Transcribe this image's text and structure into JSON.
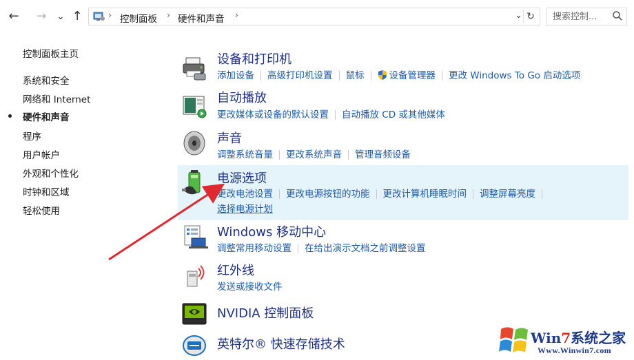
{
  "nav": {
    "back": "←",
    "forward": "→",
    "recent": "⌄",
    "up": "↑"
  },
  "address": {
    "breadcrumbs": [
      "控制面板",
      "硬件和声音"
    ],
    "separator": "›",
    "dropdown": "⌄",
    "refresh": "↻"
  },
  "search": {
    "placeholder": "搜索控制..."
  },
  "sidebar": {
    "home": "控制面板主页",
    "items": [
      {
        "label": "系统和安全"
      },
      {
        "label": "网络和 Internet"
      },
      {
        "label": "硬件和声音",
        "active": true
      },
      {
        "label": "程序"
      },
      {
        "label": "用户帐户"
      },
      {
        "label": "外观和个性化"
      },
      {
        "label": "时钟和区域"
      },
      {
        "label": "轻松使用"
      }
    ]
  },
  "categories": [
    {
      "title": "设备和打印机",
      "icon": "printer-icon",
      "links": [
        [
          "添加设备",
          "高级打印机设置",
          "鼠标",
          "设备管理器",
          "更改 Windows To Go 启动选项"
        ]
      ]
    },
    {
      "title": "自动播放",
      "icon": "autoplay-icon",
      "links": [
        [
          "更改媒体或设备的默认设置",
          "自动播放 CD 或其他媒体"
        ]
      ]
    },
    {
      "title": "声音",
      "icon": "speaker-icon",
      "links": [
        [
          "调整系统音量",
          "更改系统声音",
          "管理音频设备"
        ]
      ]
    },
    {
      "title": "电源选项",
      "icon": "battery-icon",
      "highlighted": true,
      "links": [
        [
          "更改电池设置",
          "更改电源按钮的功能",
          "更改计算机睡眠时间",
          "调整屏幕亮度"
        ],
        [
          "选择电源计划"
        ]
      ]
    },
    {
      "title": "Windows 移动中心",
      "icon": "mobility-center-icon",
      "links": [
        [
          "调整常用移动设置",
          "在给出演示文档之前调整设置"
        ]
      ]
    },
    {
      "title": "红外线",
      "icon": "infrared-icon",
      "links": [
        [
          "发送或接收文件"
        ]
      ]
    },
    {
      "title": "NVIDIA 控制面板",
      "icon": "nvidia-icon",
      "links": []
    },
    {
      "title": "英特尔® 快速存储技术",
      "icon": "intel-rst-icon",
      "links": []
    }
  ],
  "watermark": {
    "brand_a": "Win",
    "brand_b": "7",
    "brand_c": "系统之家",
    "url": "Www.Winwin7.com"
  },
  "colors": {
    "link": "#1e5aa8",
    "title": "#1e3287",
    "highlight": "#e5f3fb",
    "arrow": "#e0282e"
  }
}
